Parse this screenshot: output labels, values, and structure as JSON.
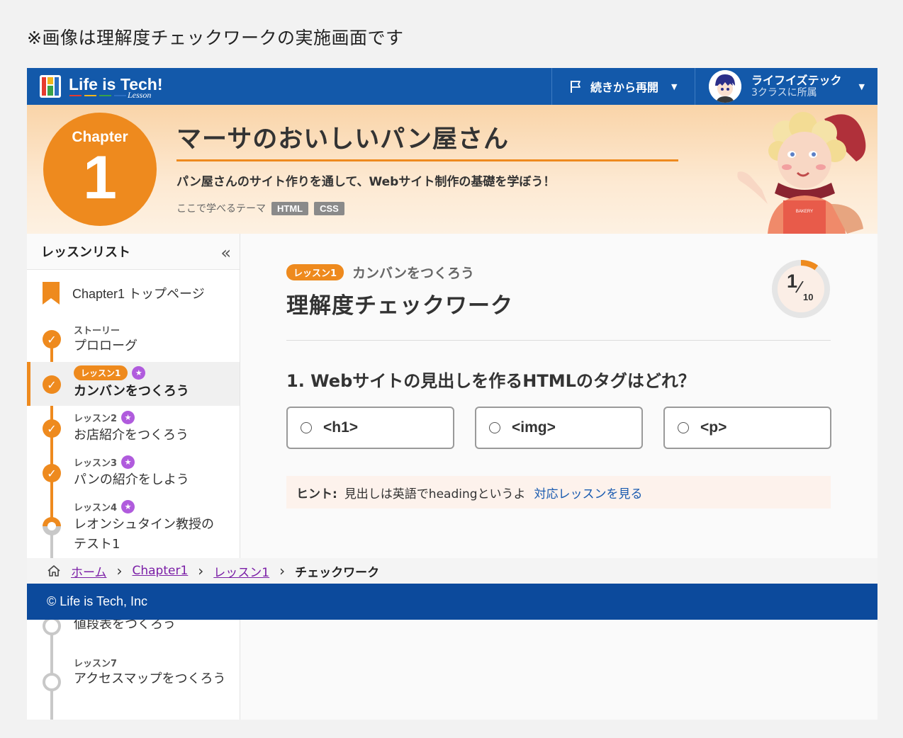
{
  "caption": "※画像は理解度チェックワークの実施画面です",
  "header": {
    "logo_text": "Life is Tech!",
    "logo_sub": "Lesson",
    "resume_label": "続きから再開",
    "user_name": "ライフイズテック",
    "user_class": "3クラスに所属"
  },
  "hero": {
    "chapter_label": "Chapter",
    "chapter_number": "1",
    "title": "マーサのおいしいパン屋さん",
    "description": "パン屋さんのサイト作りを通して、Webサイト制作の基礎を学ぼう！",
    "theme_label": "ここで学べるテーマ",
    "tags": [
      "HTML",
      "CSS"
    ]
  },
  "sidebar": {
    "title": "レッスンリスト",
    "collapse_icon": "«",
    "top_page": "Chapter1 トップページ",
    "lessons": [
      {
        "sub": "ストーリー",
        "title": "プロローグ",
        "state": "done",
        "star": false
      },
      {
        "sub": "レッスン1",
        "title": "カンバンをつくろう",
        "state": "done",
        "star": true,
        "active": true
      },
      {
        "sub": "レッスン2",
        "title": "お店紹介をつくろう",
        "state": "done",
        "star": true
      },
      {
        "sub": "レッスン3",
        "title": "パンの紹介をしよう",
        "state": "done",
        "star": true
      },
      {
        "sub": "レッスン4",
        "title": "レオンシュタイン教授の\nテスト1",
        "state": "partial",
        "star": true
      },
      {
        "sub": "",
        "title": "値段表をつくろう",
        "state": "todo",
        "star": false
      },
      {
        "sub": "レッスン7",
        "title": "アクセスマップをつくろう",
        "state": "todo",
        "star": false
      }
    ]
  },
  "main": {
    "lesson_badge": "レッスン1",
    "lesson_name": "カンバンをつくろう",
    "title": "理解度チェックワーク",
    "progress_current": "1",
    "progress_total": "10",
    "progress_fraction": 0.1,
    "question": "1. Webサイトの見出しを作るHTMLのタグはどれ？",
    "choices": [
      "<h1>",
      "<img>",
      "<p>"
    ],
    "hint_label": "ヒント:",
    "hint_text": "見出しは英語でheadingというよ",
    "hint_link": "対応レッスンを見る"
  },
  "breadcrumb": {
    "home": "ホーム",
    "chapter": "Chapter1",
    "lesson": "レッスン1",
    "current": "チェックワーク"
  },
  "footer": {
    "copyright": "© Life is Tech, Inc"
  },
  "colors": {
    "brand_blue": "#1359aa",
    "footer_blue": "#0c4a9c",
    "accent_orange": "#ee8a1e",
    "star_purple": "#b05bdd",
    "link_purple": "#7a1ea6",
    "link_blue": "#1a5bb0"
  }
}
